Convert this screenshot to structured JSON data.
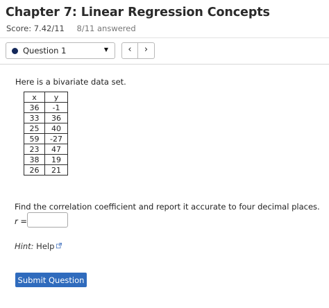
{
  "header": {
    "title": "Chapter 7: Linear Regression Concepts",
    "score": "Score: 7.42/11",
    "answered": "8/11 answered"
  },
  "question_nav": {
    "selected": "Question 1",
    "prev_glyph": "‹",
    "next_glyph": "›",
    "status_color": "#14285a"
  },
  "problem": {
    "intro": "Here is a bivariate data set.",
    "table": {
      "headers": [
        "x",
        "y"
      ],
      "rows": [
        [
          "36",
          "-1"
        ],
        [
          "33",
          "36"
        ],
        [
          "25",
          "40"
        ],
        [
          "59",
          "-27"
        ],
        [
          "23",
          "47"
        ],
        [
          "38",
          "19"
        ],
        [
          "26",
          "21"
        ]
      ]
    },
    "question": "Find the correlation coefficient and report it accurate to four decimal places.",
    "r_label": "r =",
    "answer_value": ""
  },
  "hint": {
    "label": "Hint:",
    "link": "Help"
  },
  "submit_label": "Submit Question",
  "colors": {
    "submit_bg": "#2f6bbd",
    "title": "#2a2a2a"
  }
}
